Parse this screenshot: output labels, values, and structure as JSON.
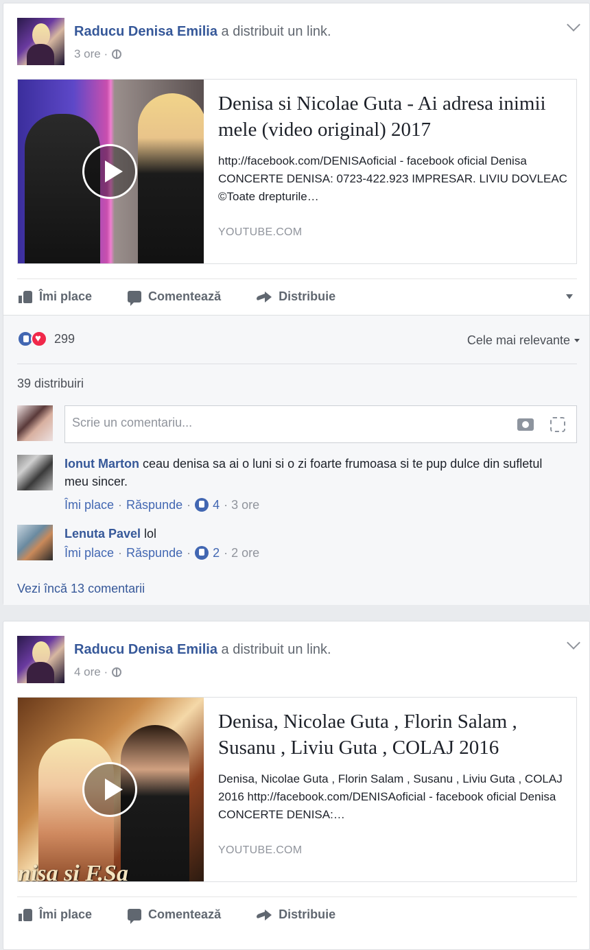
{
  "posts": [
    {
      "author": "Raducu Denisa Emilia",
      "action": " a distribuit un link.",
      "time": "3 ore ·",
      "link": {
        "title": "Denisa si Nicolae Guta - Ai adresa inimii mele (video original) 2017",
        "description": "http://facebook.com/DENISAoficial - facebook oficial Denisa CONCERTE DENISA: 0723-422.923 IMPRESAR. LIVIU DOVLEAC ©Toate drepturile…",
        "source": "YOUTUBE.COM"
      },
      "actions": {
        "like": "Îmi place",
        "comment": "Comentează",
        "share": "Distribuie"
      },
      "reactions_count": "299",
      "sort_label": "Cele mai relevante",
      "shares": "39 distribuiri",
      "comment_placeholder": "Scrie un comentariu...",
      "comments": [
        {
          "name": "Ionut Marton",
          "text": " ceau denisa sa ai o luni si o zi foarte frumoasa si te pup dulce din sufletul meu sincer.",
          "like": "Îmi place",
          "reply": "Răspunde",
          "likes": "4",
          "time": "· 3 ore"
        },
        {
          "name": "Lenuta Pavel",
          "text": " lol",
          "like": "Îmi place",
          "reply": "Răspunde",
          "likes": "2",
          "time": "· 2 ore"
        }
      ],
      "more_comments": "Vezi încă 13 comentarii"
    },
    {
      "author": "Raducu Denisa Emilia",
      "action": " a distribuit un link.",
      "time": "4 ore ·",
      "link": {
        "title": "Denisa, Nicolae Guta , Florin Salam , Susanu , Liviu Guta , COLAJ 2016",
        "description": "Denisa, Nicolae Guta , Florin Salam , Susanu , Liviu Guta , COLAJ 2016 http://facebook.com/DENISAoficial - facebook oficial Denisa CONCERTE DENISA:…",
        "source": "YOUTUBE.COM",
        "thumb_text": "nisa si F.Sa"
      },
      "actions": {
        "like": "Îmi place",
        "comment": "Comentează",
        "share": "Distribuie"
      }
    }
  ],
  "colors": {
    "link": "#365899",
    "muted": "#90949c",
    "like_blue": "#4267b2",
    "love_red": "#f0284a"
  }
}
